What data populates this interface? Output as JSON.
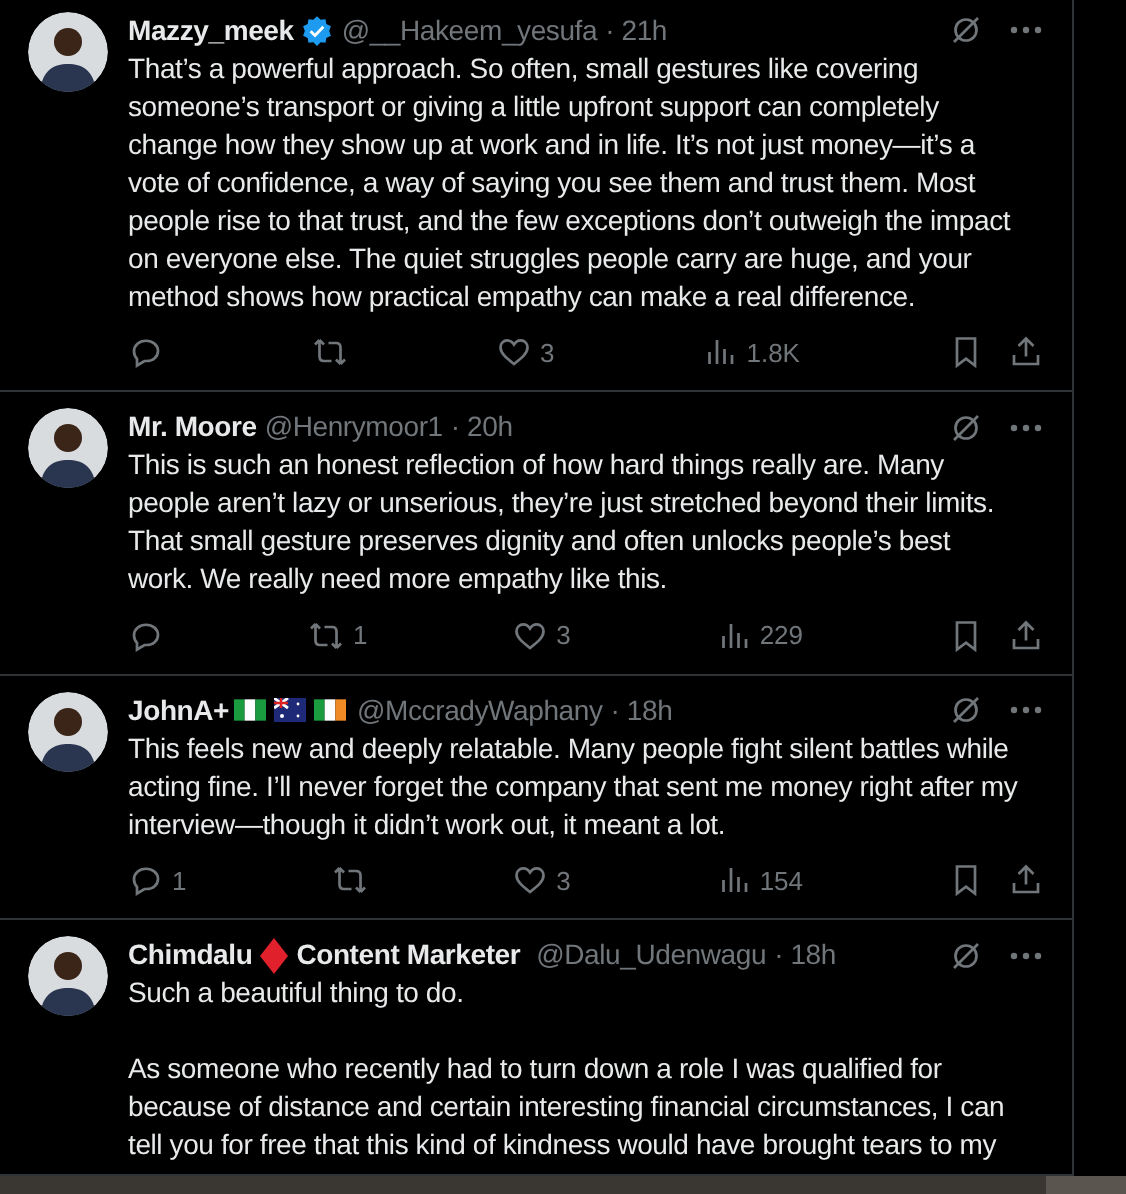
{
  "tweets": [
    {
      "name": "Mazzy_meek",
      "verified": true,
      "handle": "@__Hakeem_yesufa",
      "time": "· 21h",
      "paragraphs": [
        "That’s a powerful approach. So often, small gestures like covering someone’s transport or giving a little upfront support can completely change how they show up at work and in life. It’s not just money—it’s a vote of confidence, a way of saying you see them and trust them. Most people rise to that trust, and the few exceptions don’t outweigh the impact on everyone else. The quiet struggles people carry are huge, and your method shows how practical empathy can make a real difference."
      ],
      "likes": "3",
      "views": "1.8K"
    },
    {
      "name": "Mr. Moore",
      "verified": false,
      "handle": "@Henrymoor1",
      "time": "· 20h",
      "paragraphs": [
        "This is such an honest reflection of how hard things really are. Many people aren’t lazy or unserious, they’re just stretched beyond their limits. That small gesture preserves dignity and often unlocks people’s best work. We really need more empathy like this."
      ],
      "reposts": "1",
      "likes": "3",
      "views": "229"
    },
    {
      "name": "JohnA+",
      "verified": false,
      "emblems": [
        {
          "kind": "flag-ng"
        },
        {
          "kind": "flag-au"
        },
        {
          "kind": "flag-ie"
        }
      ],
      "handle": "@MccradyWaphany",
      "time": "· 18h",
      "paragraphs": [
        "This feels new and deeply relatable. Many people fight silent battles while acting fine. I’ll never forget the company that sent me money right after my interview—though it didn’t work out, it meant a lot."
      ],
      "replies": "1",
      "likes": "3",
      "views": "154"
    },
    {
      "name": "Chimdalu",
      "verified": false,
      "emblems": [
        {
          "kind": "diamond"
        }
      ],
      "name_suffix": "Content Marketer",
      "handle": "@Dalu_Udenwagu",
      "time": "· 18h",
      "paragraphs": [
        "Such a beautiful thing to do.",
        "As someone who recently had to turn down a role I was qualified for because of distance and certain interesting financial circumstances, I can tell you for free that this kind of kindness would have brought tears to my"
      ]
    }
  ]
}
